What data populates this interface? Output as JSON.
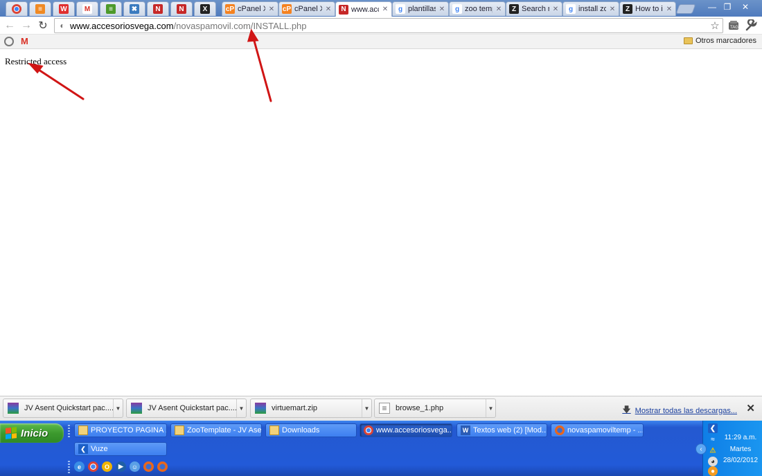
{
  "browser": {
    "pinned_tabs": [
      {
        "icon": "chrome-icon",
        "color": "#8a98b2"
      },
      {
        "icon": "blogger-icon",
        "color": "#f08a24"
      },
      {
        "icon": "office-icon",
        "color": "#e03030"
      },
      {
        "icon": "gmail-icon",
        "color": "#d93025"
      },
      {
        "icon": "bookmark-bar-icon",
        "color": "#4d9a2a"
      },
      {
        "icon": "joomla-icon",
        "color": "#3b7bbf"
      },
      {
        "icon": "site-logo-icon",
        "color": "#c62828"
      },
      {
        "icon": "site-logo-icon",
        "color": "#c62828"
      },
      {
        "icon": "xmark-icon",
        "color": "#222222"
      }
    ],
    "tabs": [
      {
        "label": "cPanel X",
        "icon": "cpanel-icon",
        "active": false
      },
      {
        "label": "cPanel X",
        "icon": "cpanel-icon",
        "active": false
      },
      {
        "label": "www.acce",
        "icon": "site-logo-icon",
        "active": true
      },
      {
        "label": "plantillas",
        "icon": "google-icon",
        "active": false
      },
      {
        "label": "zoo templ",
        "icon": "google-icon",
        "active": false
      },
      {
        "label": "Search re",
        "icon": "zoo-icon",
        "active": false
      },
      {
        "label": "install zoo",
        "icon": "google-icon",
        "active": false
      },
      {
        "label": "How to in",
        "icon": "zoo-icon",
        "active": false
      }
    ],
    "url_host": "www.accesoriosvega.com",
    "url_path": "/novaspamovil.com/INSTALL.php",
    "bookmarks_folder": "Otros marcadores"
  },
  "page": {
    "text": "Restricted access"
  },
  "downloads": {
    "items": [
      {
        "label": "JV Asent Quickstart pac....zip",
        "icon": "winrar-icon"
      },
      {
        "label": "JV Asent Quickstart pac....zip",
        "icon": "winrar-icon"
      },
      {
        "label": "virtuemart.zip",
        "icon": "winrar-icon"
      },
      {
        "label": "browse_1.php",
        "icon": "document-icon"
      }
    ],
    "show_all": "Mostrar todas las descargas..."
  },
  "taskbar": {
    "start_label": "Inicio",
    "tasks": [
      {
        "label": "PROYECTO PAGINA ...",
        "icon": "folder-icon",
        "active": false
      },
      {
        "label": "ZooTemplate - JV Ase...",
        "icon": "folder-icon",
        "active": false
      },
      {
        "label": "Downloads",
        "icon": "folder-icon",
        "active": false
      },
      {
        "label": "www.accesoriosvega...",
        "icon": "chrome-icon",
        "active": true
      },
      {
        "label": "Textos web (2) [Mod...",
        "icon": "word-icon",
        "active": false
      },
      {
        "label": "novaspamoviltemp - ...",
        "icon": "firefox-icon",
        "active": false
      },
      {
        "label": "Vuze",
        "icon": "vuze-icon",
        "active": false
      }
    ],
    "quick_launch": [
      "ie-icon",
      "chrome-icon",
      "outlook-icon",
      "media-player-icon",
      "messenger-icon",
      "firefox-icon",
      "firefox-icon"
    ],
    "clock_time": "11:29 a.m.",
    "clock_day": "Martes",
    "clock_date": "28/02/2012"
  }
}
